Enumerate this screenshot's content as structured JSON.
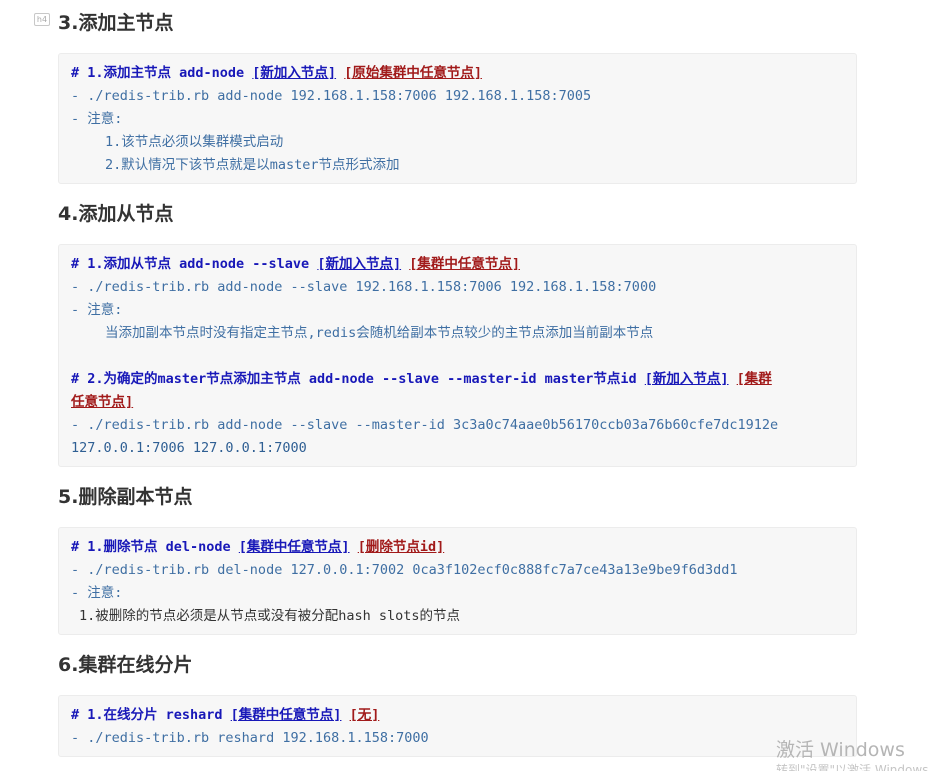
{
  "h4_marker": "h4",
  "sections": [
    {
      "title": "3.添加主节点",
      "comment": {
        "prefix": "# 1.添加主节点 add-node ",
        "new_node": "[新加入节点]",
        "space": " ",
        "existing": "[原始集群中任意节点]"
      },
      "lines": [
        "- ./redis-trib.rb  add-node 192.168.1.158:7006  192.168.1.158:7005",
        "- 注意:",
        "1.该节点必须以集群模式启动",
        "2.默认情况下该节点就是以master节点形式添加"
      ]
    },
    {
      "title": "4.添加从节点",
      "comment1": {
        "prefix": "# 1.添加从节点 add-node --slave ",
        "new_node": "[新加入节点]",
        "space": " ",
        "existing": "[集群中任意节点]"
      },
      "lines1": [
        "- ./redis-trib.rb  add-node --slave 192.168.1.158:7006 192.168.1.158:7000",
        "- 注意:",
        "当添加副本节点时没有指定主节点,redis会随机给副本节点较少的主节点添加当前副本节点"
      ],
      "comment2": {
        "prefix": "# 2.为确定的master节点添加主节点 add-node --slave --master-id master节点id ",
        "new_node": "[新加入节点]",
        "space": " ",
        "existing_a": "[集群",
        "existing_b": "任意节点]"
      },
      "lines2": [
        "- ./redis-trib.rb  add-node --slave --master-id 3c3a0c74aae0b56170ccb03a76b60cfe7dc1912e",
        "127.0.0.1:7006  127.0.0.1:7000"
      ]
    },
    {
      "title": "5.删除副本节点",
      "comment": {
        "prefix": "# 1.删除节点 del-node ",
        "new_node": "[集群中任意节点]",
        "space": " ",
        "existing": "[删除节点id]"
      },
      "lines": [
        "- ./redis-trib.rb  del-node 127.0.0.1:7002 0ca3f102ecf0c888fc7a7ce43a13e9be9f6d3dd1",
        "- 注意:",
        "1.被删除的节点必须是从节点或没有被分配hash slots的节点"
      ]
    },
    {
      "title": "6.集群在线分片",
      "comment": {
        "prefix": "# 1.在线分片 reshard ",
        "new_node": "[集群中任意节点]",
        "space": " ",
        "existing": "[无]"
      },
      "lines": [
        "- ./redis-trib.rb  reshard  192.168.1.158:7000"
      ]
    }
  ],
  "watermark": {
    "title": "激活 Windows",
    "subtitle": "转到\"设置\"以激活 Windows。"
  },
  "colors": {
    "comment_blue": "#1818b8",
    "bracket_red": "#a11a1a",
    "list_blue": "#3f6fa3",
    "code_bg": "#f7f7f7"
  }
}
